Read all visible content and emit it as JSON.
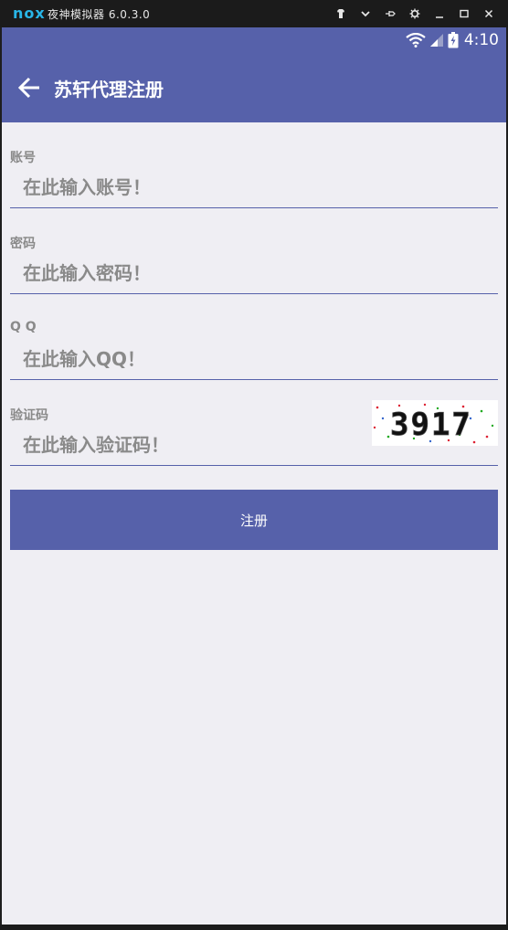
{
  "emulator": {
    "logo_text": "nox",
    "title": "夜神模拟器 6.0.3.0"
  },
  "status_bar": {
    "time": "4:10"
  },
  "toolbar": {
    "title": "苏轩代理注册"
  },
  "form": {
    "account": {
      "label": "账号",
      "placeholder": "在此输入账号！"
    },
    "password": {
      "label": "密码",
      "placeholder": "在此输入密码！"
    },
    "qq": {
      "label": "Q Q",
      "placeholder": "在此输入QQ！"
    },
    "captcha": {
      "label": "验证码",
      "placeholder": "在此输入验证码！",
      "code": "3917"
    },
    "register_label": "注册"
  },
  "colors": {
    "primary": "#5661aa",
    "background": "#efeef3"
  }
}
